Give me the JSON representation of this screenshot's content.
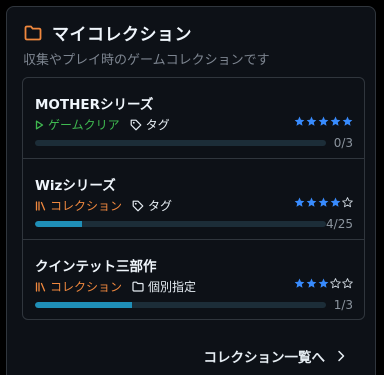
{
  "panel": {
    "title": "マイコレクション",
    "subtitle": "収集やプレイ時のゲームコレクションです",
    "accent_color": "#f0883e"
  },
  "items": [
    {
      "name": "MOTHERシリーズ",
      "primary_tag": {
        "label": "ゲームクリア",
        "icon": "play-icon",
        "color": "#3fb950"
      },
      "secondary_tag": {
        "label": "タグ",
        "icon": "tag-icon"
      },
      "rating": 5,
      "rating_max": 5,
      "progress_fraction": 0,
      "progress_text": "0/3"
    },
    {
      "name": "Wizシリーズ",
      "primary_tag": {
        "label": "コレクション",
        "icon": "library-icon",
        "color": "#f0883e"
      },
      "secondary_tag": {
        "label": "タグ",
        "icon": "tag-icon"
      },
      "rating": 4,
      "rating_max": 5,
      "progress_fraction": 0.16,
      "progress_text": "4/25"
    },
    {
      "name": "クインテット三部作",
      "primary_tag": {
        "label": "コレクション",
        "icon": "library-icon",
        "color": "#f0883e"
      },
      "secondary_tag": {
        "label": "個別指定",
        "icon": "folder-icon"
      },
      "rating": 3,
      "rating_max": 5,
      "progress_fraction": 0.333,
      "progress_text": "1/3"
    }
  ],
  "footer": {
    "link_label": "コレクション一覧へ"
  },
  "colors": {
    "star_filled": "#388bfd",
    "star_empty": "#c9d1d9",
    "progress_fill": "#1f8fb8"
  }
}
